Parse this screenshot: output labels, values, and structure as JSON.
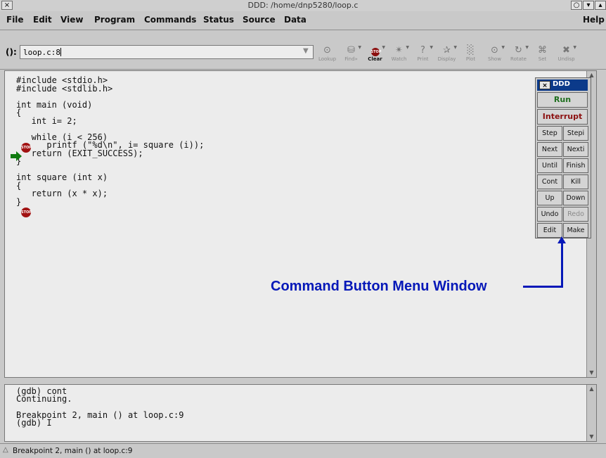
{
  "window": {
    "title": "DDD: /home/dnp5280/loop.c"
  },
  "titlebar_buttons": [
    "×",
    "○",
    "▾",
    "▴"
  ],
  "menu": [
    "File",
    "Edit",
    "View",
    "Program",
    "Commands",
    "Status",
    "Source",
    "Data"
  ],
  "menu_help": "Help",
  "toolbar": {
    "arg_label": "():",
    "arg_value": "loop.c:8",
    "tools": [
      {
        "name": "lookup",
        "label": "Lookup",
        "icon": "⊙",
        "active": true
      },
      {
        "name": "find",
        "label": "Find»",
        "icon": "⛁",
        "active": false
      },
      {
        "name": "clear",
        "label": "Clear",
        "icon": "STOP",
        "active": true
      },
      {
        "name": "watch",
        "label": "Watch",
        "icon": "✴",
        "active": false
      },
      {
        "name": "print",
        "label": "Print",
        "icon": "?",
        "active": false
      },
      {
        "name": "display",
        "label": "Display",
        "icon": "✰",
        "active": false
      },
      {
        "name": "plot",
        "label": "Plot",
        "icon": "░",
        "active": false
      },
      {
        "name": "show",
        "label": "Show",
        "icon": "⊙",
        "active": false
      },
      {
        "name": "rotate",
        "label": "Rotate",
        "icon": "↻",
        "active": false
      },
      {
        "name": "set",
        "label": "Set",
        "icon": "⌘",
        "active": false
      },
      {
        "name": "undisp",
        "label": "Undisp",
        "icon": "✖",
        "active": false
      }
    ]
  },
  "source": {
    "lines": "#include <stdio.h>\n#include <stdlib.h>\n\nint main (void)\n{\n   int i= 2;\n\n   while (i < 256)\n      printf (\"%d\\n\", i= square (i));\n   return (EXIT_SUCCESS);\n}\n\nint square (int x)\n{\n   return (x * x);\n}",
    "breakpoint_label": "STOP"
  },
  "gdb": {
    "lines": "(gdb) cont\nContinuing.\n\nBreakpoint 2, main () at loop.c:9\n(gdb) "
  },
  "status": "Breakpoint 2, main () at loop.c:9",
  "command_window": {
    "title": "DDD",
    "close": "×",
    "run": "Run",
    "interrupt": "Interrupt",
    "buttons": [
      [
        "Step",
        "Stepi"
      ],
      [
        "Next",
        "Nexti"
      ],
      [
        "Until",
        "Finish"
      ],
      [
        "Cont",
        "Kill"
      ],
      [
        "Up",
        "Down"
      ],
      [
        "Undo",
        "Redo"
      ],
      [
        "Edit",
        "Make"
      ]
    ]
  },
  "annotation": "Command Button Menu Window",
  "colors": {
    "accent": "#0618b8",
    "title_bar": "#0b3a8a",
    "stop_sign": "#a11212",
    "run": "#1e6f1e",
    "interrupt": "#8b0f0f"
  }
}
